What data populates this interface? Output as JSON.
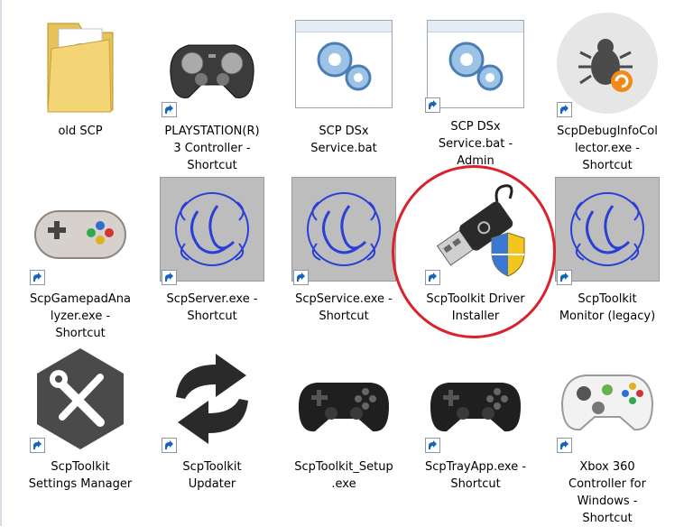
{
  "items": [
    {
      "label": "old SCP",
      "icon": "folder-icon"
    },
    {
      "label": "PLAYSTATION(R)\n3 Controller -\nShortcut",
      "icon": "gamepad-icon"
    },
    {
      "label": "SCP DSx\nService.bat",
      "icon": "gears-window-icon"
    },
    {
      "label": "SCP DSx\nService.bat -\nAdmin",
      "icon": "gears-window-icon"
    },
    {
      "label": "ScpDebugInfoCol\nlector.exe -\nShortcut",
      "icon": "bug-icon"
    },
    {
      "label": "ScpGamepadAna\nlyzer.exe -\nShortcut",
      "icon": "snes-controller-icon"
    },
    {
      "label": "ScpServer.exe -\nShortcut",
      "icon": "scp-logo-icon"
    },
    {
      "label": "ScpService.exe -\nShortcut",
      "icon": "scp-logo-icon"
    },
    {
      "label": "ScpToolkit Driver\nInstaller",
      "icon": "usb-shield-icon"
    },
    {
      "label": "ScpToolkit\nMonitor (legacy)",
      "icon": "scp-logo-icon"
    },
    {
      "label": "ScpToolkit\nSettings Manager",
      "icon": "tools-hexagon-icon"
    },
    {
      "label": "ScpToolkit\nUpdater",
      "icon": "refresh-arrows-icon"
    },
    {
      "label": "ScpToolkit_Setup\n.exe",
      "icon": "ds3-controller-icon"
    },
    {
      "label": "ScpTrayApp.exe -\nShortcut",
      "icon": "ds3-controller-icon"
    },
    {
      "label": "Xbox 360\nController for\nWindows -\nShortcut",
      "icon": "xbox-controller-icon"
    }
  ],
  "colors": {
    "highlight_circle": "#d9222b",
    "shortcut_arrow": "#1565c0",
    "scp_logo_blue": "#2a3fd6",
    "thumbnail_gray": "#bdbdbd"
  }
}
